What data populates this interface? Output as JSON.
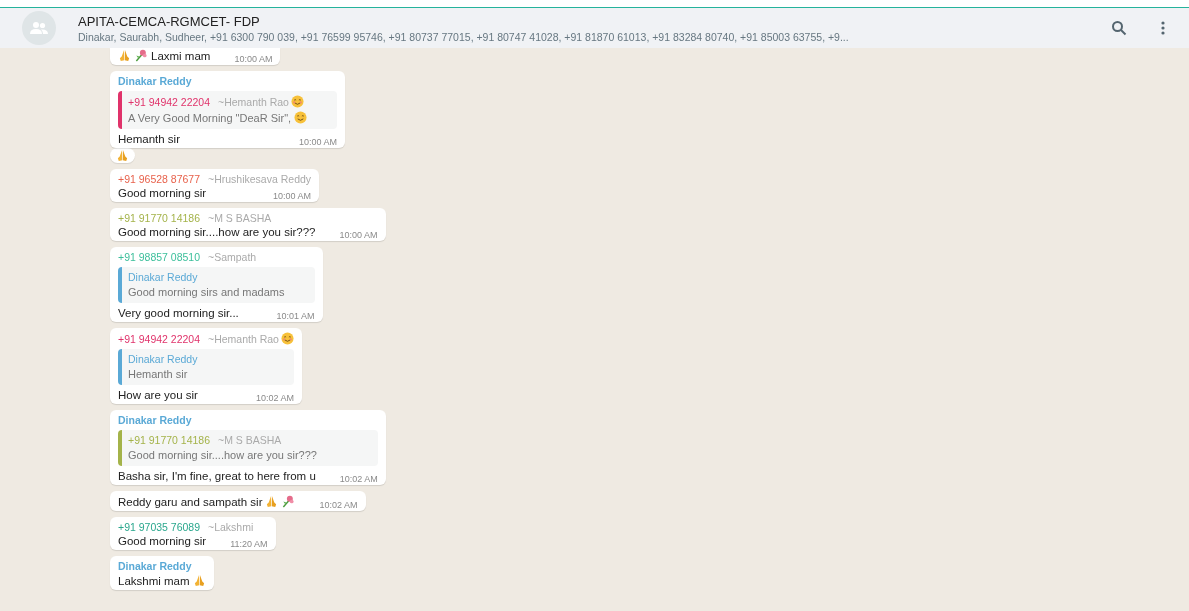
{
  "header": {
    "title": "APITA-CEMCA-RGMCET- FDP",
    "subtitle": "Dinakar, Saurabh, Sudheer, +91 6300 790 039, +91 76599 95746, +91 80737 77015, +91 80747 41028, +91 81870 61013, +91 83284 80740, +91 85003 63755, +9..."
  },
  "messages": [
    {
      "text": "Laxmi mam",
      "lead_emojis": [
        {
          "kind": "pray"
        },
        {
          "kind": "flower"
        }
      ],
      "time": "10:00 AM"
    },
    {
      "sender": {
        "name": "Dinakar Reddy",
        "color": "#5aa9d6"
      },
      "quote": {
        "phone": "+91 94942 22204",
        "author": "~Hemanth Rao",
        "author_emoji": {
          "kind": "blush"
        },
        "color": "#e0336b",
        "text": "A Very Good Morning \"DeaR Sir\",",
        "text_emoji": {
          "kind": "smile"
        }
      },
      "text": "Hemanth sir",
      "time": "10:00 AM",
      "reactions": [
        {
          "kind": "pray"
        }
      ]
    },
    {
      "sender": {
        "phone": "+91 96528 87677",
        "name": "~Hrushikesava Reddy",
        "color": "#e8624c"
      },
      "text": "Good morning sir",
      "time": "10:00 AM"
    },
    {
      "sender": {
        "phone": "+91 91770 14186",
        "name": "~M S BASHA",
        "color": "#a4b34a"
      },
      "text": "Good morning sir....how are you sir???",
      "time": "10:00 AM"
    },
    {
      "sender": {
        "phone": "+91 98857 08510",
        "name": "~Sampath",
        "color": "#3cbf9b"
      },
      "quote": {
        "author": "Dinakar Reddy",
        "color": "#5aa9d6",
        "text": "Good morning sirs and madams"
      },
      "text": "Very good morning sir...",
      "time": "10:01 AM"
    },
    {
      "sender": {
        "phone": "+91 94942 22204",
        "name": "~Hemanth Rao",
        "name_emoji": {
          "kind": "blush"
        },
        "color": "#e0336b"
      },
      "quote": {
        "author": "Dinakar Reddy",
        "color": "#5aa9d6",
        "text": "Hemanth sir"
      },
      "text": "How are you sir",
      "time": "10:02 AM"
    },
    {
      "sender": {
        "name": "Dinakar Reddy",
        "color": "#5aa9d6"
      },
      "quote": {
        "phone": "+91 91770 14186",
        "author": "~M S BASHA",
        "color": "#a4b34a",
        "text": "Good morning sir....how are you sir???"
      },
      "text": "Basha sir, I'm fine, great to here from u",
      "time": "10:02 AM"
    },
    {
      "text": "Reddy garu and sampath sir",
      "trail_emojis": [
        {
          "kind": "pray"
        },
        {
          "kind": "flower"
        }
      ],
      "time": "10:02 AM"
    },
    {
      "sender": {
        "phone": "+91 97035 76089",
        "name": "~Lakshmi",
        "color": "#2aa78d"
      },
      "text": "Good morning sir",
      "time": "11:20 AM"
    },
    {
      "sender": {
        "name": "Dinakar Reddy",
        "color": "#5aa9d6"
      },
      "text": "Lakshmi mam",
      "trail_emojis": [
        {
          "kind": "pray"
        }
      ]
    }
  ]
}
